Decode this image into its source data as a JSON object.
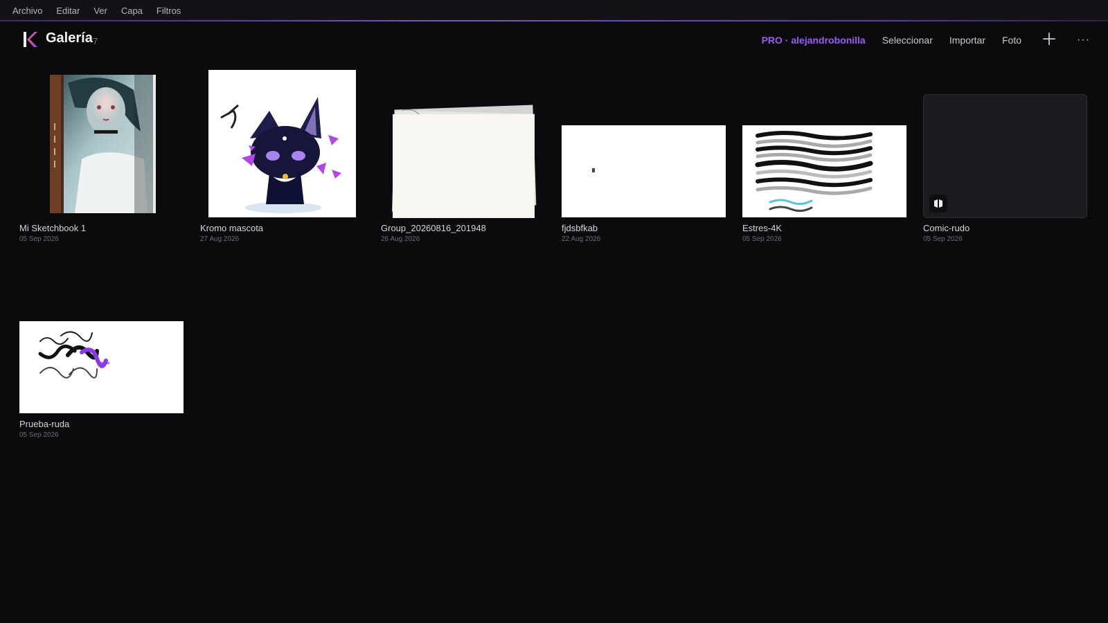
{
  "menubar": {
    "items": [
      "Archivo",
      "Editar",
      "Ver",
      "Capa",
      "Filtros"
    ]
  },
  "header": {
    "title": "Galería",
    "count": "7",
    "pro_label": "PRO · alejandrobonilla",
    "actions": [
      "Seleccionar",
      "Importar",
      "Foto"
    ],
    "add_icon": "plus-icon",
    "more_icon": "ellipsis-icon"
  },
  "colors": {
    "accent": "#9a5cf0",
    "background": "#0b0b0e"
  },
  "gallery": {
    "items": [
      {
        "title": "Mi Sketchbook 1",
        "date": "05 Sep 2026",
        "kind": "sketchbook"
      },
      {
        "title": "Kromo mascota",
        "date": "27 Aug 2026",
        "kind": "artwork"
      },
      {
        "title": "Group_20260816_201948",
        "date": "26 Aug 2026",
        "kind": "stack"
      },
      {
        "title": "fjdsbfkab",
        "date": "22 Aug 2026",
        "kind": "artwork"
      },
      {
        "title": "Estres-4K",
        "date": "05 Sep 2026",
        "kind": "artwork"
      },
      {
        "title": "Comic-rudo",
        "date": "05 Sep 2026",
        "kind": "comic"
      },
      {
        "title": "Prueba-ruda",
        "date": "05 Sep 2026",
        "kind": "artwork"
      }
    ]
  }
}
